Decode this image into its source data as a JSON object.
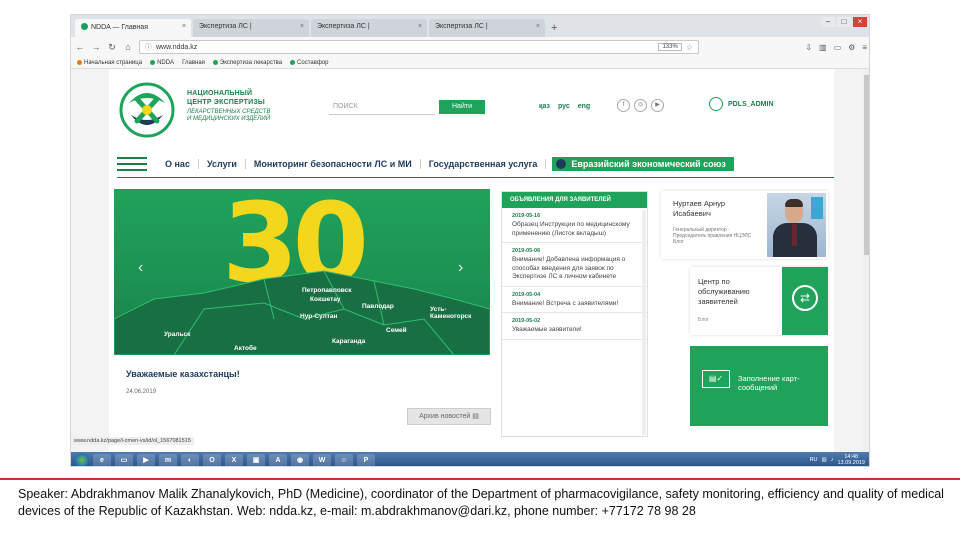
{
  "browser": {
    "tabs": [
      {
        "label": "NDDA — Главная",
        "active": true
      },
      {
        "label": "Экспертиза ЛС |",
        "active": false
      },
      {
        "label": "Экспертиза ЛС |",
        "active": false
      },
      {
        "label": "Экспертиза ЛС |",
        "active": false
      }
    ],
    "new_tab": "+",
    "url": "www.ndda.kz",
    "zoom": "133%",
    "bookmarks": [
      "Начальная страница",
      "NDDA",
      "Главная",
      "Экспертиза лекарства",
      "Составфор"
    ]
  },
  "header": {
    "org_name_line1": "НАЦИОНАЛЬНЫЙ",
    "org_name_line2": "ЦЕНТР ЭКСПЕРТИЗЫ",
    "org_sub_line1": "ЛЕКАРСТВЕННЫХ СРЕДСТВ",
    "org_sub_line2": "И МЕДИЦИНСКИХ ИЗДЕЛИЙ",
    "search_placeholder": "ПОИСК",
    "search_button": "Найти",
    "langs": [
      "қаз",
      "рус",
      "eng"
    ],
    "user_name": "PDLS_ADMIN"
  },
  "menu": {
    "items": [
      "О нас",
      "Услуги",
      "Мониторинг безопасности ЛС и МИ",
      "Государственная услуга"
    ],
    "eaeu": "Евразийский экономический союз"
  },
  "slider": {
    "big_number": "30",
    "cities": [
      "Петропавловск",
      "Кокшетау",
      "Павлодар",
      "Нур-Султан",
      "Усть-Каменогорск",
      "Семей",
      "Уральск",
      "Актобе",
      "Караганда"
    ],
    "caption_title": "Уважаемые казахстанцы!",
    "caption_date": "24.06.2019",
    "archive_button": "Архив новостей"
  },
  "announcements": {
    "header": "ОБЪЯВЛЕНИЯ ДЛЯ ЗАЯВИТЕЛЕЙ",
    "items": [
      {
        "date": "2019-05-16",
        "text": "Образец Инструкции по медицинскому применению (Листок вкладыш)"
      },
      {
        "date": "2019-05-06",
        "text": "Внимание! Добавлена информация о способах введения для заявок по Экспертизе ЛС в личном кабинете"
      },
      {
        "date": "2019-05-04",
        "text": "Внимание! Встреча с заявителями!"
      },
      {
        "date": "2019-05-02",
        "text": "Уважаемые заявители!"
      }
    ]
  },
  "cards": {
    "director_name_line1": "Нуртаев Арнур",
    "director_name_line2": "Исабаевич",
    "director_position": "Генеральный директор · Председатель правления НЦЭЛС Блог",
    "service_line1": "Центр по",
    "service_line2": "обслуживанию",
    "service_line3": "заявителей",
    "service_sub": "Блог",
    "cards_title_line1": "Заполнение карт-",
    "cards_title_line2": "сообщений"
  },
  "status_url": "www.ndda.kz/page/i-zmen-vs/id/ol_1567081515",
  "taskbar": {
    "lang": "RU",
    "time": "14:48",
    "date": "13.09.2019"
  },
  "speaker": "Speaker: Abdrakhmanov Malik Zhanalykovich, PhD (Medicine), coordinator of the Department of pharmacovigilance, safety monitoring, efficiency and quality of medical devices of the Republic of Kazakhstan. Web: ndda.kz, e-mail: m.abdrakhmanov@dari.kz, phone number: +77172 78 98 28",
  "colors": {
    "brand_green": "#1fa35b",
    "navy": "#1c3a5c",
    "yellow": "#f2d71c"
  }
}
